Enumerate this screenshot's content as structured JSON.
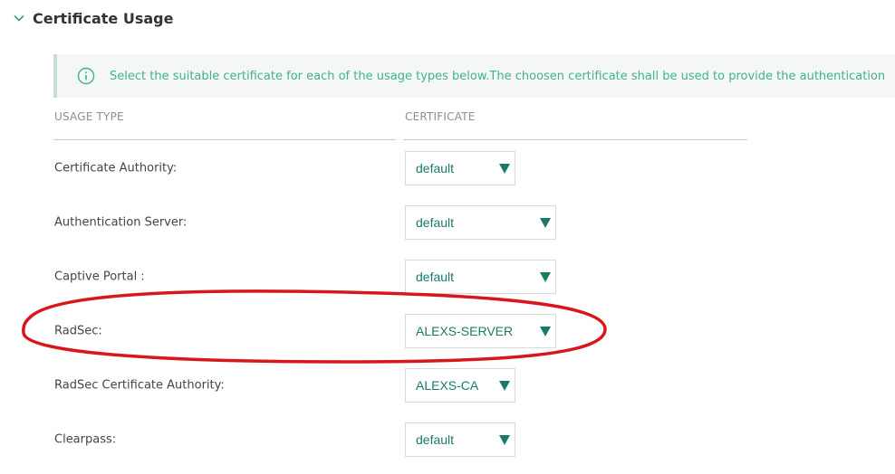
{
  "section": {
    "title": "Certificate Usage",
    "chevron_icon": "chevron-down-icon"
  },
  "banner": {
    "icon": "info-icon",
    "text": "Select the suitable certificate for each of the usage types below.The choosen certificate shall be used to provide the authentication"
  },
  "table": {
    "headers": {
      "usage_type": "USAGE TYPE",
      "certificate": "CERTIFICATE"
    },
    "rows": [
      {
        "label": "Certificate Authority:",
        "value": "default"
      },
      {
        "label": "Authentication Server:",
        "value": "default"
      },
      {
        "label": "Captive Portal :",
        "value": "default"
      },
      {
        "label": "RadSec:",
        "value": "ALEXS-SERVER"
      },
      {
        "label": "RadSec Certificate Authority:",
        "value": "ALEXS-CA"
      },
      {
        "label": "Clearpass:",
        "value": "default"
      }
    ]
  },
  "colors": {
    "accent": "#1a7a68",
    "banner_text": "#3fb28e",
    "annotation": "#d9161c"
  }
}
